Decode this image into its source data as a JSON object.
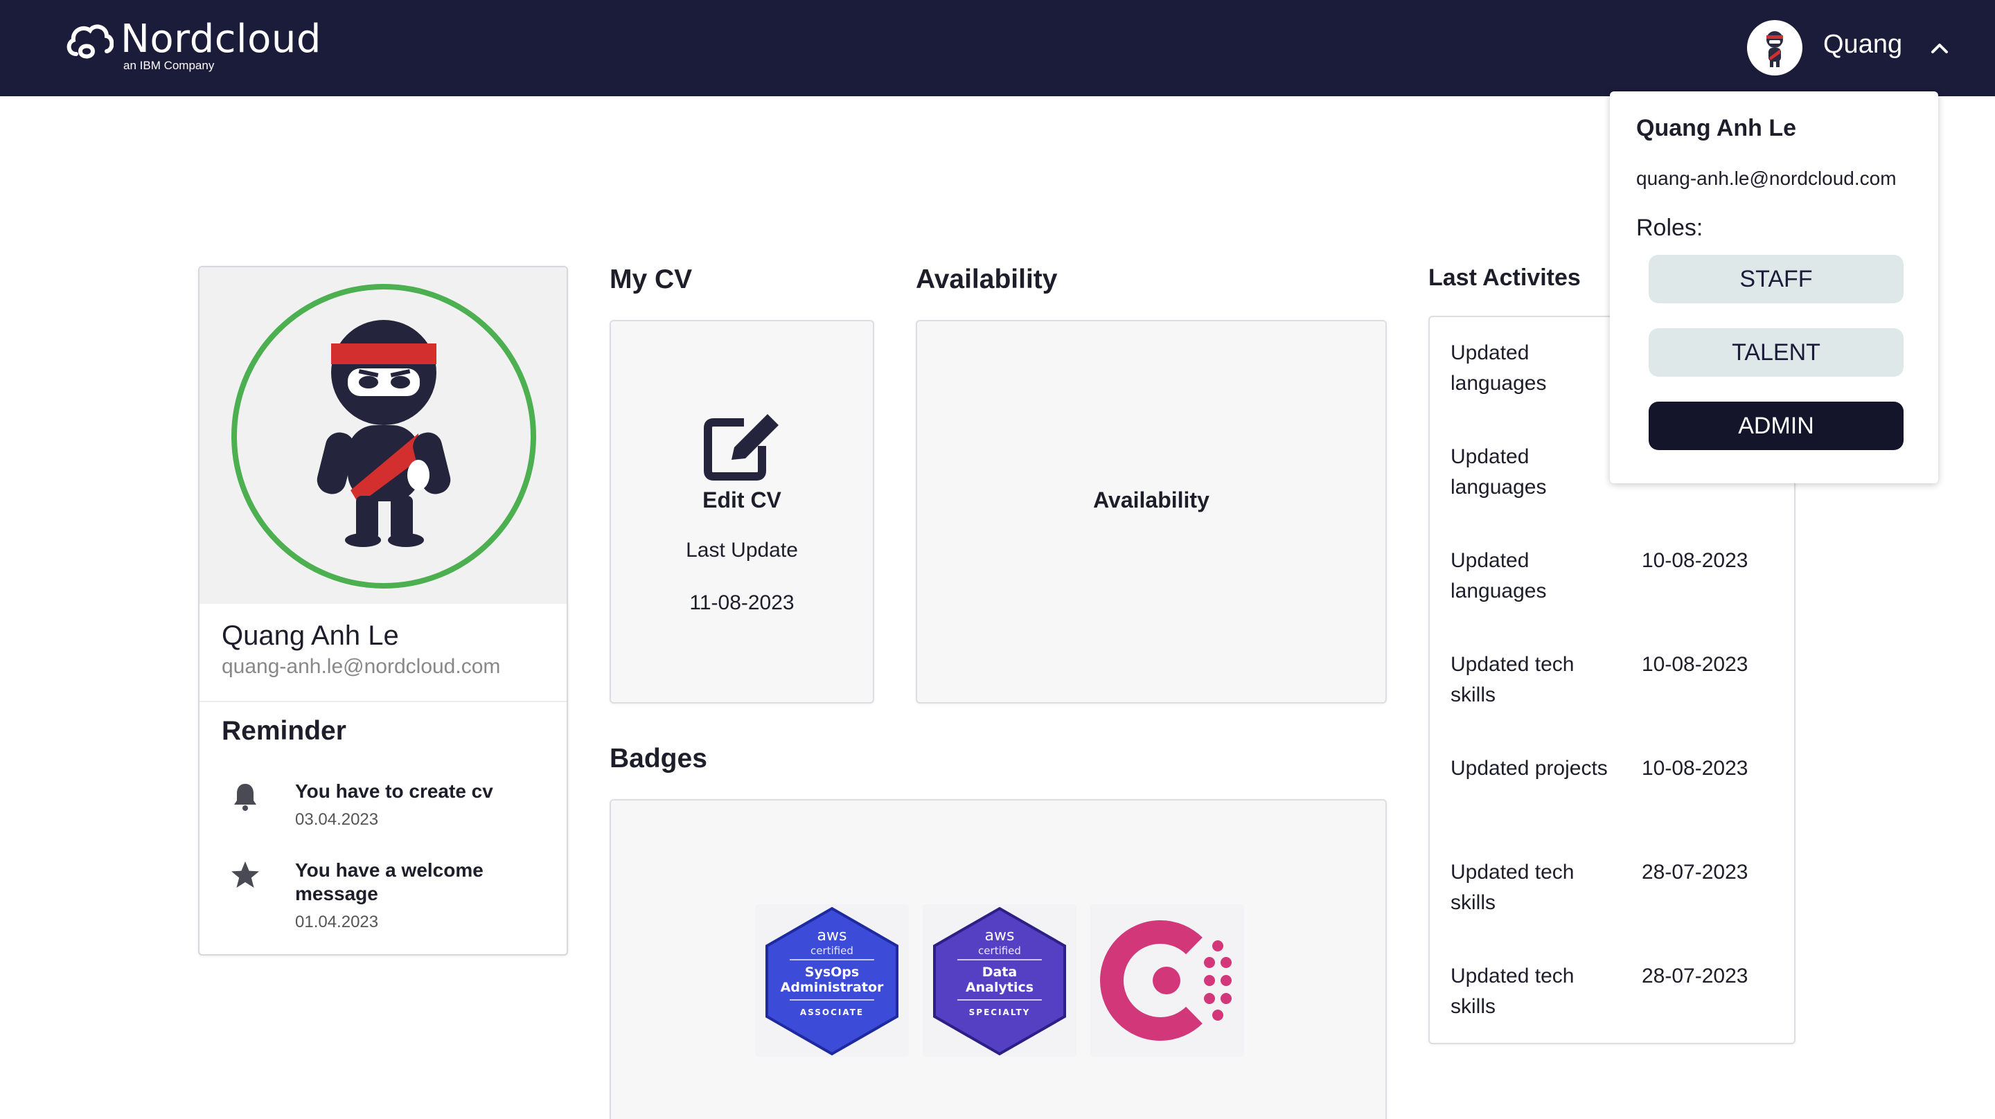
{
  "header": {
    "brand": "Nordcloud",
    "sub_brand": "an IBM Company",
    "user_short_name": "Quang"
  },
  "profile": {
    "name": "Quang Anh Le",
    "email": "quang-anh.le@nordcloud.com"
  },
  "reminder": {
    "title": "Reminder",
    "items": [
      {
        "icon": "bell-icon",
        "text": "You have to create cv",
        "date": "03.04.2023"
      },
      {
        "icon": "star-icon",
        "text": "You have a welcome message",
        "date": "01.04.2023"
      }
    ]
  },
  "my_cv": {
    "title": "My CV",
    "edit_label": "Edit CV",
    "last_update_label": "Last Update",
    "last_update_date": "11-08-2023"
  },
  "availability": {
    "title": "Availability",
    "card_label": "Availability"
  },
  "badges": {
    "title": "Badges",
    "items": [
      {
        "name": "aws-sysops-administrator-associate",
        "vendor": "aws",
        "cert": "certified",
        "line1": "SysOps",
        "line2": "Administrator",
        "level": "ASSOCIATE",
        "color": "#2f3fc7"
      },
      {
        "name": "aws-data-analytics-specialty",
        "vendor": "aws",
        "cert": "certified",
        "line1": "Data",
        "line2": "Analytics",
        "level": "SPECIALTY",
        "color": "#4b35b8"
      },
      {
        "name": "consul-logo",
        "color": "#d2377a"
      }
    ]
  },
  "activities": {
    "title": "Last Activites",
    "items": [
      {
        "text": "Updated languages",
        "date": ""
      },
      {
        "text": "Updated languages",
        "date": ""
      },
      {
        "text": "Updated languages",
        "date": "10-08-2023"
      },
      {
        "text": "Updated tech skills",
        "date": "10-08-2023"
      },
      {
        "text": "Updated projects",
        "date": "10-08-2023"
      },
      {
        "text": "Updated tech skills",
        "date": "28-07-2023"
      },
      {
        "text": "Updated tech skills",
        "date": "28-07-2023"
      }
    ]
  },
  "user_menu": {
    "name": "Quang Anh Le",
    "email": "quang-anh.le@nordcloud.com",
    "roles_label": "Roles:",
    "roles": [
      "STAFF",
      "TALENT",
      "ADMIN"
    ],
    "active_role": "ADMIN"
  },
  "colors": {
    "header_bg": "#1b1b3a",
    "avatar_ring": "#4caf50",
    "role_inactive": "#dfe8e8",
    "role_active": "#14142b"
  }
}
